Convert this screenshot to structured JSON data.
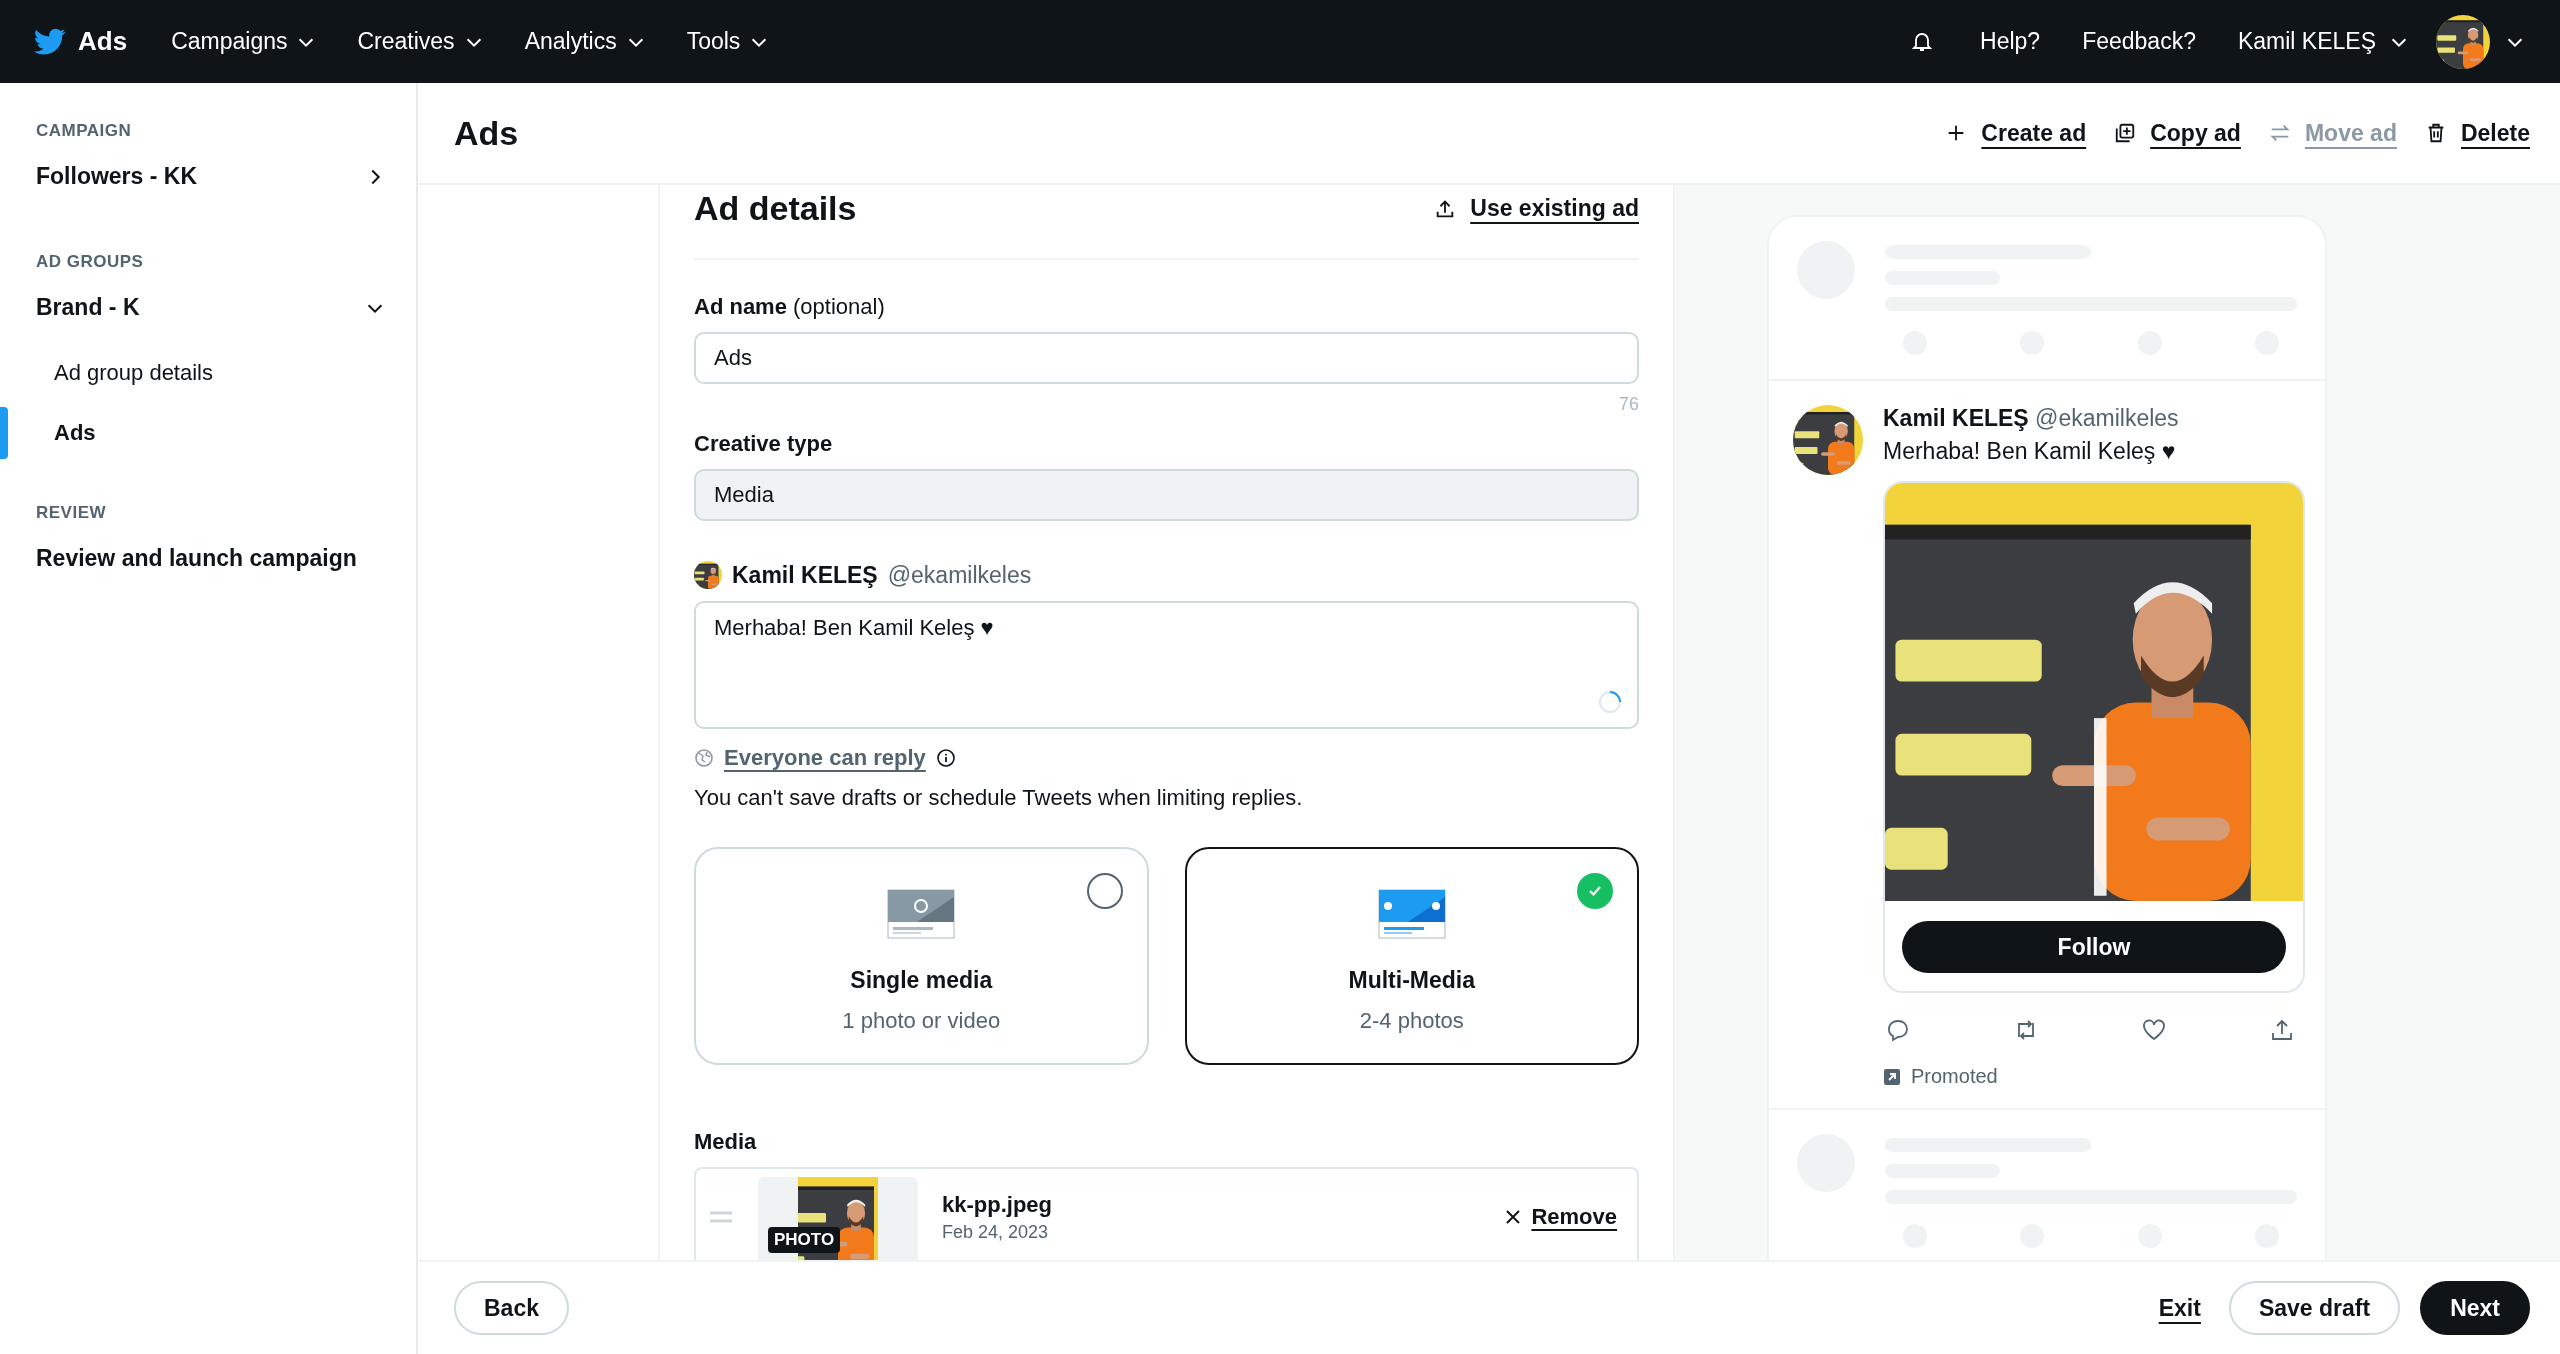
{
  "topbar": {
    "brand": "Ads",
    "nav": [
      {
        "label": "Campaigns"
      },
      {
        "label": "Creatives"
      },
      {
        "label": "Analytics"
      },
      {
        "label": "Tools"
      }
    ],
    "links": [
      {
        "label": "Help?"
      },
      {
        "label": "Feedback?"
      }
    ],
    "user": "Kamil KELEŞ"
  },
  "sidebar": {
    "sections": [
      {
        "heading": "CAMPAIGN",
        "items": [
          {
            "label": "Followers - KK",
            "kind": "group",
            "expanded": false,
            "selected": false
          }
        ]
      },
      {
        "heading": "AD GROUPS",
        "items": [
          {
            "label": "Brand - K",
            "kind": "group",
            "expanded": true,
            "selected": false,
            "children": [
              {
                "label": "Ad group details",
                "selected": false
              },
              {
                "label": "Ads",
                "selected": true
              }
            ]
          }
        ]
      },
      {
        "heading": "REVIEW",
        "items": [
          {
            "label": "Review and launch campaign",
            "kind": "link",
            "selected": false
          }
        ]
      }
    ]
  },
  "header": {
    "title": "Ads",
    "actions": [
      {
        "label": "Create ad",
        "kind": "create",
        "disabled": false
      },
      {
        "label": "Copy ad",
        "kind": "copy",
        "disabled": false
      },
      {
        "label": "Move ad",
        "kind": "move",
        "disabled": true
      },
      {
        "label": "Delete",
        "kind": "delete",
        "disabled": false
      }
    ]
  },
  "form": {
    "title": "Ad details",
    "use_existing": "Use existing ad",
    "ad_name": {
      "label": "Ad name",
      "hint": "(optional)",
      "value": "Ads",
      "counter": "76"
    },
    "creative_type": {
      "label": "Creative type",
      "value": "Media"
    },
    "tweet": {
      "author": "Kamil KELEŞ",
      "handle": "@ekamilkeles",
      "text": "Merhaba! Ben Kamil Keleş ♥"
    },
    "reply": {
      "label": "Everyone can reply",
      "note": "You can't save drafts or schedule Tweets when limiting replies."
    },
    "options": [
      {
        "title": "Single media",
        "subtitle": "1 photo or video",
        "kind": "single",
        "selected": false
      },
      {
        "title": "Multi-Media",
        "subtitle": "2-4 photos",
        "kind": "multi",
        "selected": true
      }
    ],
    "media": {
      "label": "Media",
      "items": [
        {
          "name": "kk-pp.jpeg",
          "date": "Feb 24, 2023",
          "badge": "PHOTO",
          "action": "Remove"
        }
      ]
    }
  },
  "preview": {
    "author": "Kamil KELEŞ",
    "handle": "@ekamilkeles",
    "text": "Merhaba! Ben Kamil Keleş ♥",
    "button": "Follow",
    "promoted": "Promoted"
  },
  "footer": {
    "back": "Back",
    "exit": "Exit",
    "save": "Save draft",
    "next": "Next"
  }
}
